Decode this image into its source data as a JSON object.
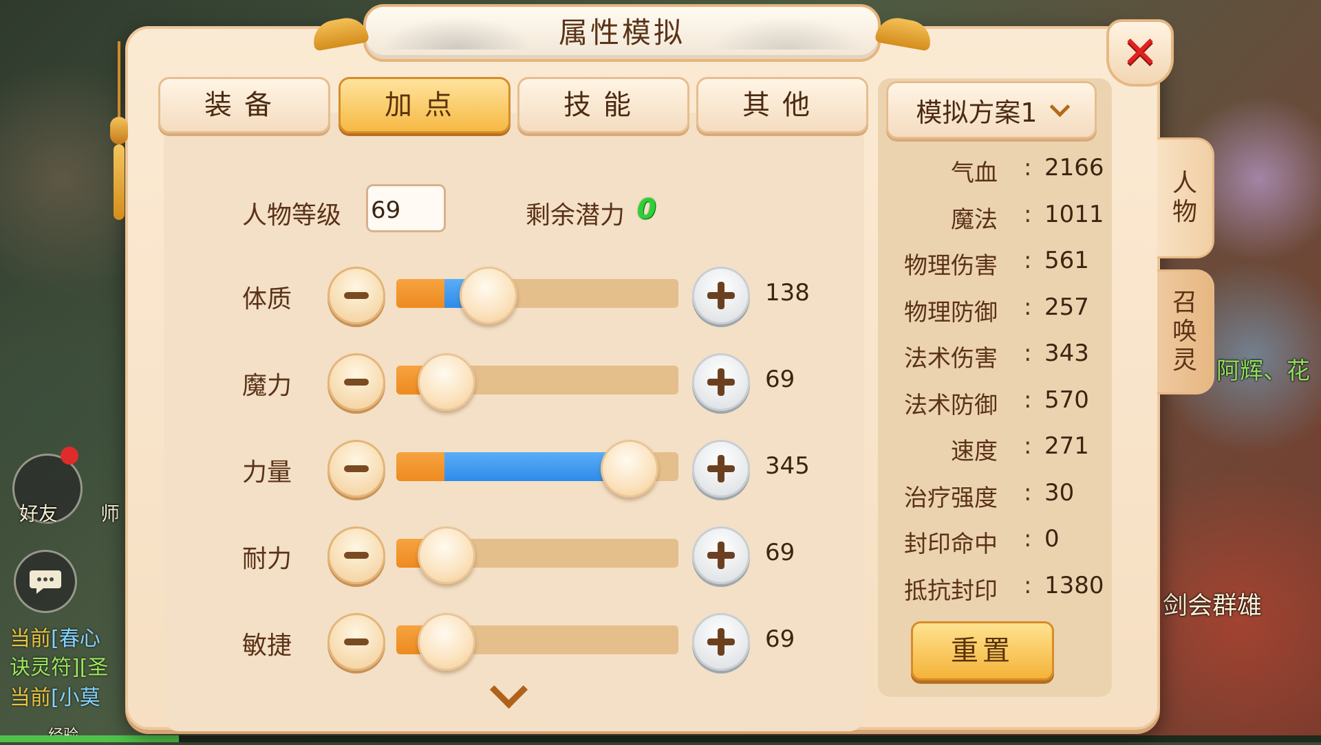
{
  "hud": {
    "friends_label": "好友",
    "master_label": "师",
    "chat_lines": [
      {
        "channel": "当前",
        "text": "[春心"
      },
      {
        "channel": "",
        "text": "诀灵符][圣"
      },
      {
        "channel": "当前",
        "text": "[小莫"
      }
    ],
    "exp_label": "经验",
    "right_texts": [
      "阿辉、花",
      "剑会群雄"
    ]
  },
  "dialog": {
    "title": "属性模拟",
    "close_glyph": "✕",
    "tabs": [
      {
        "label": "装备",
        "active": false
      },
      {
        "label": "加点",
        "active": true
      },
      {
        "label": "技能",
        "active": false
      },
      {
        "label": "其他",
        "active": false
      }
    ],
    "plan_dropdown": "模拟方案1",
    "side_tabs": [
      {
        "label": "人物",
        "active": true
      },
      {
        "label": "召唤灵",
        "active": false
      }
    ],
    "level_label": "人物等级",
    "level_value": "69",
    "remain_label": "剩余潜力",
    "remain_value": "0",
    "attributes": [
      {
        "name": "体质",
        "value": "138",
        "base_fraction": 0.17,
        "fill_fraction": 0.32
      },
      {
        "name": "魔力",
        "value": "69",
        "base_fraction": 0.17,
        "fill_fraction": 0.17
      },
      {
        "name": "力量",
        "value": "345",
        "base_fraction": 0.17,
        "fill_fraction": 0.82
      },
      {
        "name": "耐力",
        "value": "69",
        "base_fraction": 0.17,
        "fill_fraction": 0.17
      },
      {
        "name": "敏捷",
        "value": "69",
        "base_fraction": 0.17,
        "fill_fraction": 0.17
      }
    ],
    "stats": [
      {
        "name": "气血",
        "value": "2166"
      },
      {
        "name": "魔法",
        "value": "1011"
      },
      {
        "name": "物理伤害",
        "value": "561"
      },
      {
        "name": "物理防御",
        "value": "257"
      },
      {
        "name": "法术伤害",
        "value": "343"
      },
      {
        "name": "法术防御",
        "value": "570"
      },
      {
        "name": "速度",
        "value": "271"
      },
      {
        "name": "治疗强度",
        "value": "30"
      },
      {
        "name": "封印命中",
        "value": "0"
      },
      {
        "name": "抵抗封印",
        "value": "1380"
      }
    ],
    "reset_label": "重置"
  },
  "colors": {
    "accent_orange": "#f6b944",
    "slider_blue": "#2f8bea",
    "remain_green": "#2bd136",
    "close_red": "#e0231f"
  },
  "icons": {
    "close": "close-icon",
    "minus": "minus-icon",
    "plus": "plus-icon",
    "dropdown": "chevron-down-icon",
    "scroll": "chevron-down-icon"
  }
}
